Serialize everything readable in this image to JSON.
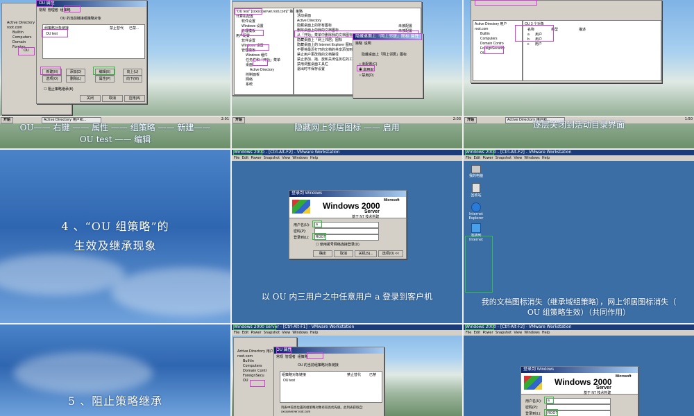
{
  "colors": {
    "highlight_pink": "#d63adf",
    "highlight_green": "#30c040",
    "slide_blue": "#2f66b0"
  },
  "p1": {
    "window_title": "OU 属性",
    "tabs": [
      "常规",
      "管理者",
      "组策略"
    ],
    "tree": [
      "Active Directory",
      "root.com",
      "Builtin",
      "Computers",
      "Domain",
      "Foreign",
      "OU"
    ],
    "link_text": "OU 的当前链接组策略对象",
    "col_headers": [
      "组策略对象链接",
      "禁止替代",
      "已禁..."
    ],
    "gpo": "OU test",
    "buttons": [
      "新建(N)",
      "添加(D)",
      "编辑(E)",
      "选项(O)",
      "删除(L)",
      "属性(P)",
      "向上(U)",
      "向下(W)"
    ],
    "block_label": "阻止策略继承(B)",
    "bottom_buttons": [
      "关闭",
      "取消",
      "应用(A)"
    ],
    "taskbar": "Active Directory 用户和...",
    "start": "开始",
    "clock": "2:01",
    "caption": "OU—— 右键 —— 属性 —— 组策略 —— 新建——OU test —— 编辑"
  },
  "p2": {
    "tree": [
      "\"OU test\" [xxxxxxserver.root.com]\" 策",
      "计算机配置",
      "软件设置",
      "Windows 设置",
      "管理模板",
      "用户配置",
      "软件设置",
      "Windows 设置",
      "管理模板",
      "Windows 组件",
      "任务栏和「开始」菜单",
      "桌面",
      "Active Directory",
      "控制面板",
      "网络",
      "系统"
    ],
    "col_header": "策略",
    "list": [
      "活动桌面",
      "Active Directory",
      "隐藏桌面上的所有图标",
      "删除桌面上的我的文档图标",
      "从「开始」菜单中删除我的文档图标",
      "隐藏桌面上「网上邻居」图标",
      "隐藏桌面上的 Internet Explorer 图标",
      "不要将最近打开的文档的共享添加到...",
      "禁止用户更改我的文档路径",
      "禁止添加、拖、放和关闭任务栏的工...",
      "禁用调整桌面工具栏",
      "退出时不保存设置"
    ],
    "state": [
      "未被配置",
      "未被配置"
    ],
    "dialog_title": "隐藏桌面上「网上邻居」图标 属性",
    "dialog_tabs": [
      "策略",
      "说明"
    ],
    "dialog_text": "隐藏桌面上「网上邻居」图标",
    "options": [
      "未配置(C)",
      "启用(E)",
      "禁用(D)"
    ],
    "clock": "2:03",
    "caption": "隐藏网上邻居图标 —— 启用"
  },
  "p3": {
    "tree": [
      "Active Directory 用户",
      "root.com",
      "Builtin",
      "Computers",
      "Domain Contro",
      "ForeignSecurity",
      "OU"
    ],
    "path": "OU 3 个对象",
    "cols": [
      "名称",
      "类型",
      "描述"
    ],
    "rows": [
      [
        "a",
        "用户"
      ],
      [
        "b",
        "用户"
      ],
      [
        "c",
        "用户"
      ]
    ],
    "clock": "1:50",
    "caption": "逐层关闭到活动目录界面"
  },
  "p4": {
    "line1": "4 、“OU 组策略”的",
    "line2": "生效及继承现象"
  },
  "p5": {
    "vm_title": "Windows 2000 - [Ctrl-Alt-F2] - VMware Workstation",
    "menu": [
      "File",
      "Edit",
      "Power",
      "Snapshot",
      "View",
      "Windows",
      "Help"
    ],
    "login_title": "登录到 Windows",
    "copyright": "Copyright © 1985-1999 Microsoft Corporation",
    "brand": "Microsoft",
    "windows": "Windows",
    "version": "2000",
    "server": "Server",
    "tech": "基于 NT 技术构建",
    "user_label": "用户名(U):",
    "user_value": "a",
    "pass_label": "密码(P):",
    "domain_label": "登录到(L):",
    "domain_value": "ROOT",
    "dialup": "使用拨号网络连接登录(D)",
    "buttons": [
      "确定",
      "取消",
      "关机(S)...",
      "选项(O) <<"
    ],
    "caption": "以 OU 内三用户之中任意用户 a 登录到客户机"
  },
  "p6": {
    "vm_title": "Windows 2000 - [Ctrl-Alt-F2] - VMware Workstation",
    "menu": [
      "File",
      "Edit",
      "Power",
      "Snapshot",
      "View",
      "Windows",
      "Help"
    ],
    "icons": [
      "我的电脑",
      "回收站",
      "Internet Explorer",
      "连接到 Internet"
    ],
    "caption": "我的文档图标消失（继承域组策略），网上邻居图标消失（ OU 组策略生效）（共同作用）"
  },
  "p7": {
    "line1": "5 、阻止策略继承"
  },
  "p8": {
    "vm_title": "Windows 2000 server - [Ctrl-Alt-F1] - VMware Workstation",
    "menu": [
      "File",
      "Edit",
      "Power",
      "Snapshot",
      "View",
      "Windows",
      "Help"
    ],
    "window_title": "OU 属性",
    "tabs": [
      "常规",
      "管理者",
      "组策略"
    ],
    "tree": [
      "Active Directory 用户",
      "root.com",
      "Builtin",
      "Computers",
      "Domain Contr",
      "ForeignSecu",
      "OU"
    ],
    "link_text": "OU 的当前组策略对象链接",
    "col_headers": [
      "组策略对象链接",
      "禁止替代",
      "已禁"
    ],
    "gpo": "OU test",
    "note": "列表中较高位置的组策略对象有较高优先级。此列表获取自: xxxxxserver.root.com"
  },
  "p9": {
    "vm_title": "Windows 2000 - [Ctrl-Alt-F2] - VMware Workstation",
    "menu": [
      "File",
      "Edit",
      "Power",
      "Snapshot",
      "View",
      "Windows",
      "Help"
    ],
    "login_title": "登录到 Windows",
    "brand": "Microsoft",
    "windows": "Windows",
    "version": "2000",
    "server": "Server",
    "tech": "基于 NT 技术构建",
    "user_label": "用户名(U):",
    "user_value": "a",
    "pass_label": "密码(P):",
    "domain_label": "登录到(L):",
    "domain_value": "ROOT"
  }
}
